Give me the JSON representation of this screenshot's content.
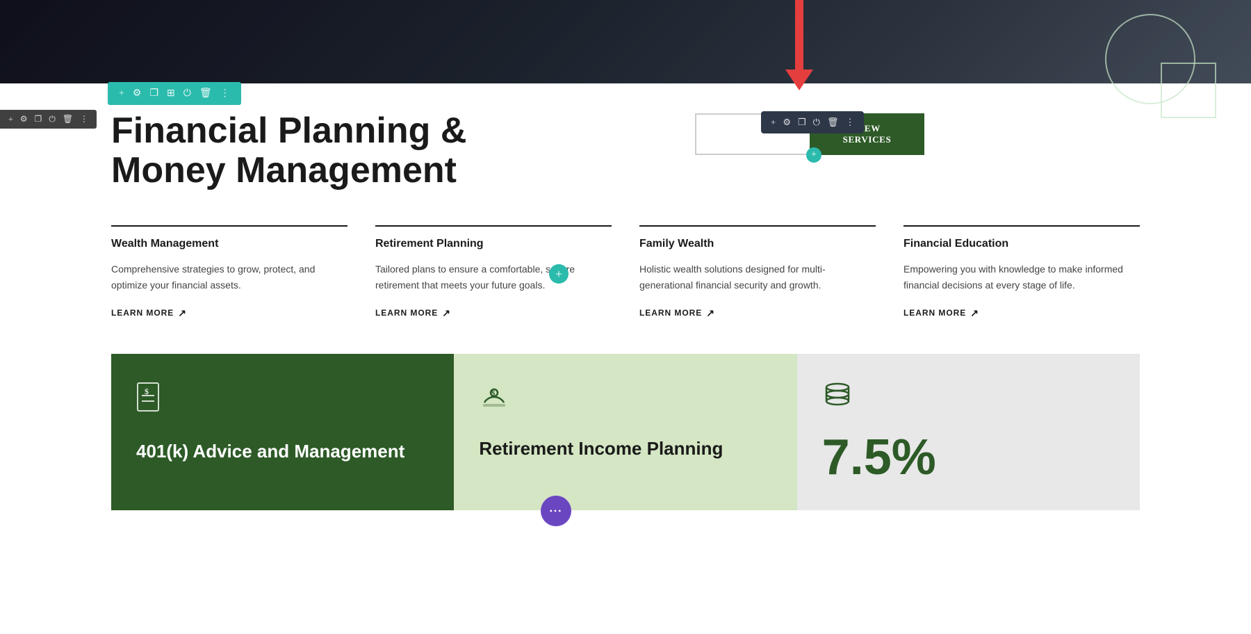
{
  "hero": {
    "bg_description": "Dark laptop workspace background"
  },
  "page_title": "Financial Planning & Money Management",
  "top_toolbar": {
    "icons": [
      "plus",
      "gear",
      "copy",
      "grid",
      "power",
      "trash",
      "dots"
    ]
  },
  "second_toolbar": {
    "icons": [
      "plus",
      "gear",
      "copy",
      "power",
      "trash",
      "dots"
    ]
  },
  "floating_toolbar": {
    "icons": [
      "plus",
      "gear",
      "copy",
      "power",
      "trash",
      "dots"
    ]
  },
  "view_services_button": "VIEW SERVICES",
  "plus_button_label": "+",
  "services": [
    {
      "title": "Wealth Management",
      "description": "Comprehensive strategies to grow, protect, and optimize your financial assets.",
      "learn_more": "LEARN MORE"
    },
    {
      "title": "Retirement Planning",
      "description": "Tailored plans to ensure a comfortable, secure retirement that meets your future goals.",
      "learn_more": "LEARN MORE"
    },
    {
      "title": "Family Wealth",
      "description": "Holistic wealth solutions designed for multi-generational financial security and growth.",
      "learn_more": "LEARN MORE"
    },
    {
      "title": "Financial Education",
      "description": "Empowering you with knowledge to make informed financial decisions at every stage of life.",
      "learn_more": "LEARN MORE"
    }
  ],
  "bottom_cards": [
    {
      "type": "dark",
      "icon": "📄",
      "title": "401(k) Advice and Management"
    },
    {
      "type": "light_green",
      "icon": "💵",
      "title": "Retirement Income Planning"
    },
    {
      "type": "gray",
      "icon": "🪙",
      "stat": "7.5%",
      "title": ""
    }
  ],
  "colors": {
    "teal": "#2bbbad",
    "dark_green": "#2d5a27",
    "light_green_bg": "#d4e6c3",
    "gray_bg": "#e8e8e8",
    "red_arrow": "#e53e3e",
    "dark_toolbar": "#2d3748",
    "purple": "#6b46c1"
  }
}
